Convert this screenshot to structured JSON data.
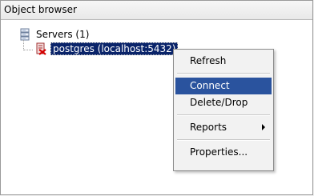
{
  "panel": {
    "title": "Object browser"
  },
  "tree": {
    "servers_label": "Servers (1)",
    "server_icon": "server-group-icon",
    "postgres_label": "postgres (localhost:5432)",
    "postgres_icon": "disconnected-server-icon"
  },
  "context_menu": {
    "items": [
      {
        "label": "Refresh"
      },
      {
        "label": "Connect",
        "highlighted": true
      },
      {
        "label": "Delete/Drop"
      },
      {
        "label": "Reports",
        "has_submenu": true
      },
      {
        "label": "Properties..."
      }
    ]
  },
  "colors": {
    "selection": "#0a246a",
    "menu_highlight": "#2a539e"
  }
}
